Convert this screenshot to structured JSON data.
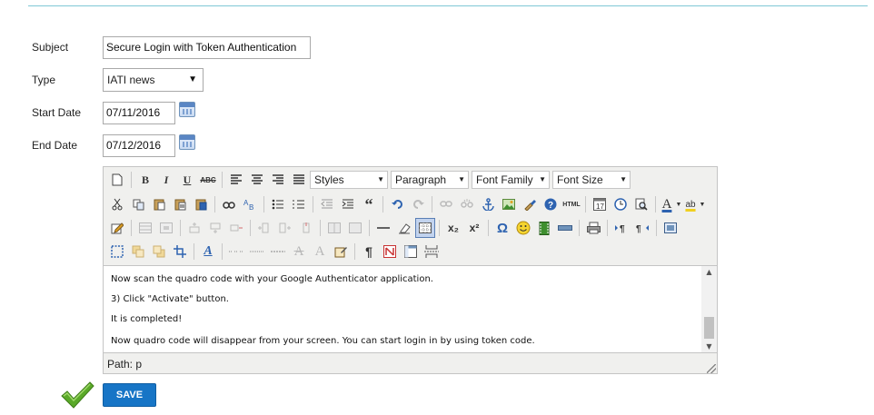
{
  "form": {
    "subject_label": "Subject",
    "subject_value": "Secure Login with Token Authentication",
    "type_label": "Type",
    "type_value": "IATI news",
    "start_label": "Start Date",
    "start_value": "07/11/2016",
    "end_label": "End Date",
    "end_value": "07/12/2016"
  },
  "editor": {
    "dropdowns": {
      "styles": "Styles",
      "paragraph": "Paragraph",
      "font_family": "Font Family",
      "font_size": "Font Size"
    },
    "glyphs": {
      "bold": "B",
      "italic": "I",
      "underline": "U",
      "strike": "ABC",
      "html": "HTML",
      "sub": "x₂",
      "sup": "x²",
      "omega": "Ω",
      "pilcrow": "¶",
      "font_color": "A",
      "highlight": "ab",
      "quote": "“",
      "calendar_num": "17"
    },
    "content": [
      "Now scan the quadro code with your Google Authenticator application.",
      "3) Click \"Activate\" button.",
      "It is completed!",
      "Now quadro code will disappear from your screen. You can start login in by using token code."
    ],
    "path": "Path: p"
  },
  "actions": {
    "save_label": "SAVE"
  },
  "colors": {
    "accent": "#1775c6",
    "top_line": "#7fc8d6",
    "check": "#5aa928"
  }
}
